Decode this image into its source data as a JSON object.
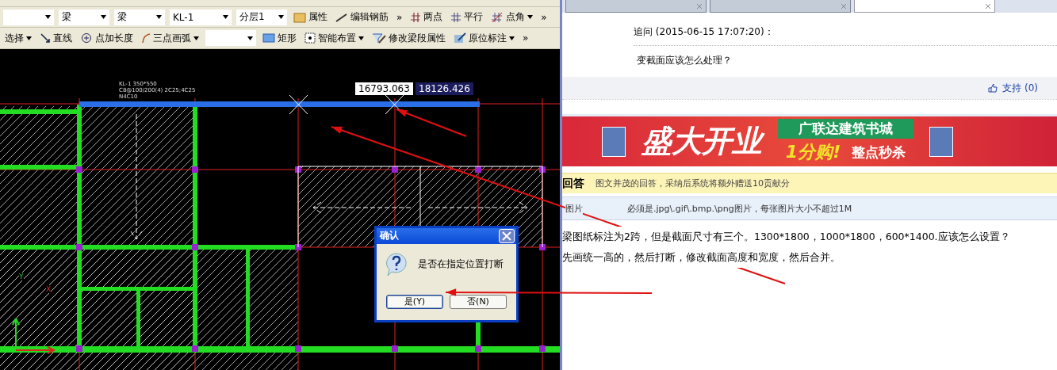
{
  "cad": {
    "toolbar_1": [
      {
        "kind": "dropdown"
      },
      {
        "kind": "dropdown",
        "label": "梁"
      },
      {
        "kind": "dropdown",
        "label": "梁"
      },
      {
        "kind": "dropdown",
        "label": "KL-1"
      },
      {
        "kind": "dropdown",
        "label": "分层1"
      },
      {
        "kind": "button",
        "label": "属性"
      },
      {
        "kind": "button",
        "label": "编辑钢筋"
      },
      {
        "kind": "more",
        "label": "»"
      },
      {
        "kind": "button",
        "label": "两点"
      },
      {
        "kind": "button",
        "label": "平行"
      },
      {
        "kind": "menu",
        "label": "点角"
      },
      {
        "kind": "more",
        "label": "»"
      }
    ],
    "toolbar_2": [
      {
        "kind": "menu",
        "label": "选择"
      },
      {
        "kind": "button",
        "label": "直线"
      },
      {
        "kind": "button",
        "label": "点加长度"
      },
      {
        "kind": "menu",
        "label": "三点画弧"
      },
      {
        "kind": "dropdown"
      },
      {
        "kind": "button",
        "label": "矩形"
      },
      {
        "kind": "menu",
        "label": "智能布置"
      },
      {
        "kind": "button",
        "label": "修改梁段属性"
      },
      {
        "kind": "menu",
        "label": "原位标注"
      },
      {
        "kind": "more",
        "label": "»"
      }
    ],
    "beam_label": [
      "KL-1 350*550",
      "C8@100/200(4) 2C25;4C25",
      "N4C10"
    ],
    "coord_inputs": [
      {
        "value": "16793.063",
        "selected": false
      },
      {
        "value": "18126.426",
        "selected": true
      }
    ],
    "axis_labels": [
      "Y",
      "X"
    ],
    "dialog": {
      "title": "确认",
      "message": "是否在指定位置打断",
      "buttons": [
        {
          "label": "是(Y)",
          "selected": true
        },
        {
          "label": "否(N)",
          "selected": false
        }
      ]
    }
  },
  "browser": {
    "tabs": [
      {
        "selected": false
      },
      {
        "selected": false
      },
      {
        "selected": true
      }
    ],
    "followup": {
      "heading": "追问 (2015-06-15 17:07:20)：",
      "text": "变截面应该怎么处理？",
      "support": "支持 (0)"
    },
    "banner": {
      "headline": "盛大开业",
      "store": "广联达建筑书城",
      "offer": "1分购!",
      "sale": "整点秒杀"
    },
    "answer": {
      "title": "回答",
      "hint": "图文并茂的回答，采纳后系统将额外赠送10贡献分"
    },
    "image_row": {
      "label": "图片",
      "hint": "必须是.jpg\\.gif\\.bmp.\\png图片，每张图片大小不超过1M"
    },
    "answer_text": [
      "梁图纸标注为2跨，但是截面尺寸有三个。1300*1800，1000*1800，600*1400.应该怎么设置？",
      "先画统一高的，然后打断，修改截面高度和宽度，然后合并。"
    ]
  }
}
